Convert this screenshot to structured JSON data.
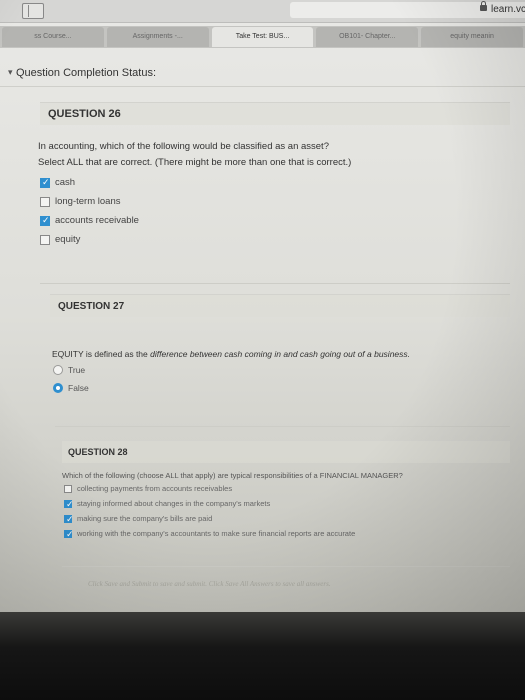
{
  "browser": {
    "url": "learn.vc"
  },
  "tabs": [
    {
      "label": "ss Course...",
      "active": false
    },
    {
      "label": "Assignments -...",
      "active": false
    },
    {
      "label": "Take Test: BUS...",
      "active": true
    },
    {
      "label": "OB101- Chapter...",
      "active": false
    },
    {
      "label": "equity meanin",
      "active": false
    }
  ],
  "status": {
    "label": "Question Completion Status:"
  },
  "questions": [
    {
      "title": "QUESTION 26",
      "prompt": "In accounting, which of the following would be classified as an asset?",
      "instruction": "Select ALL that are correct. (There might be more than one that is correct.)",
      "options": [
        {
          "label": "cash",
          "checked": true
        },
        {
          "label": "long-term loans",
          "checked": false
        },
        {
          "label": "accounts receivable",
          "checked": true
        },
        {
          "label": "equity",
          "checked": false
        }
      ]
    },
    {
      "title": "QUESTION 27",
      "prompt_prefix": "EQUITY is defined as the ",
      "prompt_emphasis": "difference between cash coming in and cash going out of a business.",
      "options": [
        {
          "label": "True",
          "checked": false
        },
        {
          "label": "False",
          "checked": true
        }
      ]
    },
    {
      "title": "QUESTION 28",
      "prompt": "Which of the following (choose ALL that apply) are typical responsibilities of a FINANCIAL MANAGER?",
      "options": [
        {
          "label": "collecting payments from accounts receivables",
          "checked": false
        },
        {
          "label": "staying informed about changes in the company's markets",
          "checked": true
        },
        {
          "label": "making sure the company's bills are paid",
          "checked": true
        },
        {
          "label": "working with the company's accountants to make sure financial reports are accurate",
          "checked": true
        }
      ]
    }
  ],
  "footer": {
    "note": "Click Save and Submit to save and submit. Click Save All Answers to save all answers."
  },
  "colors": {
    "accent": "#2f8fcf"
  }
}
